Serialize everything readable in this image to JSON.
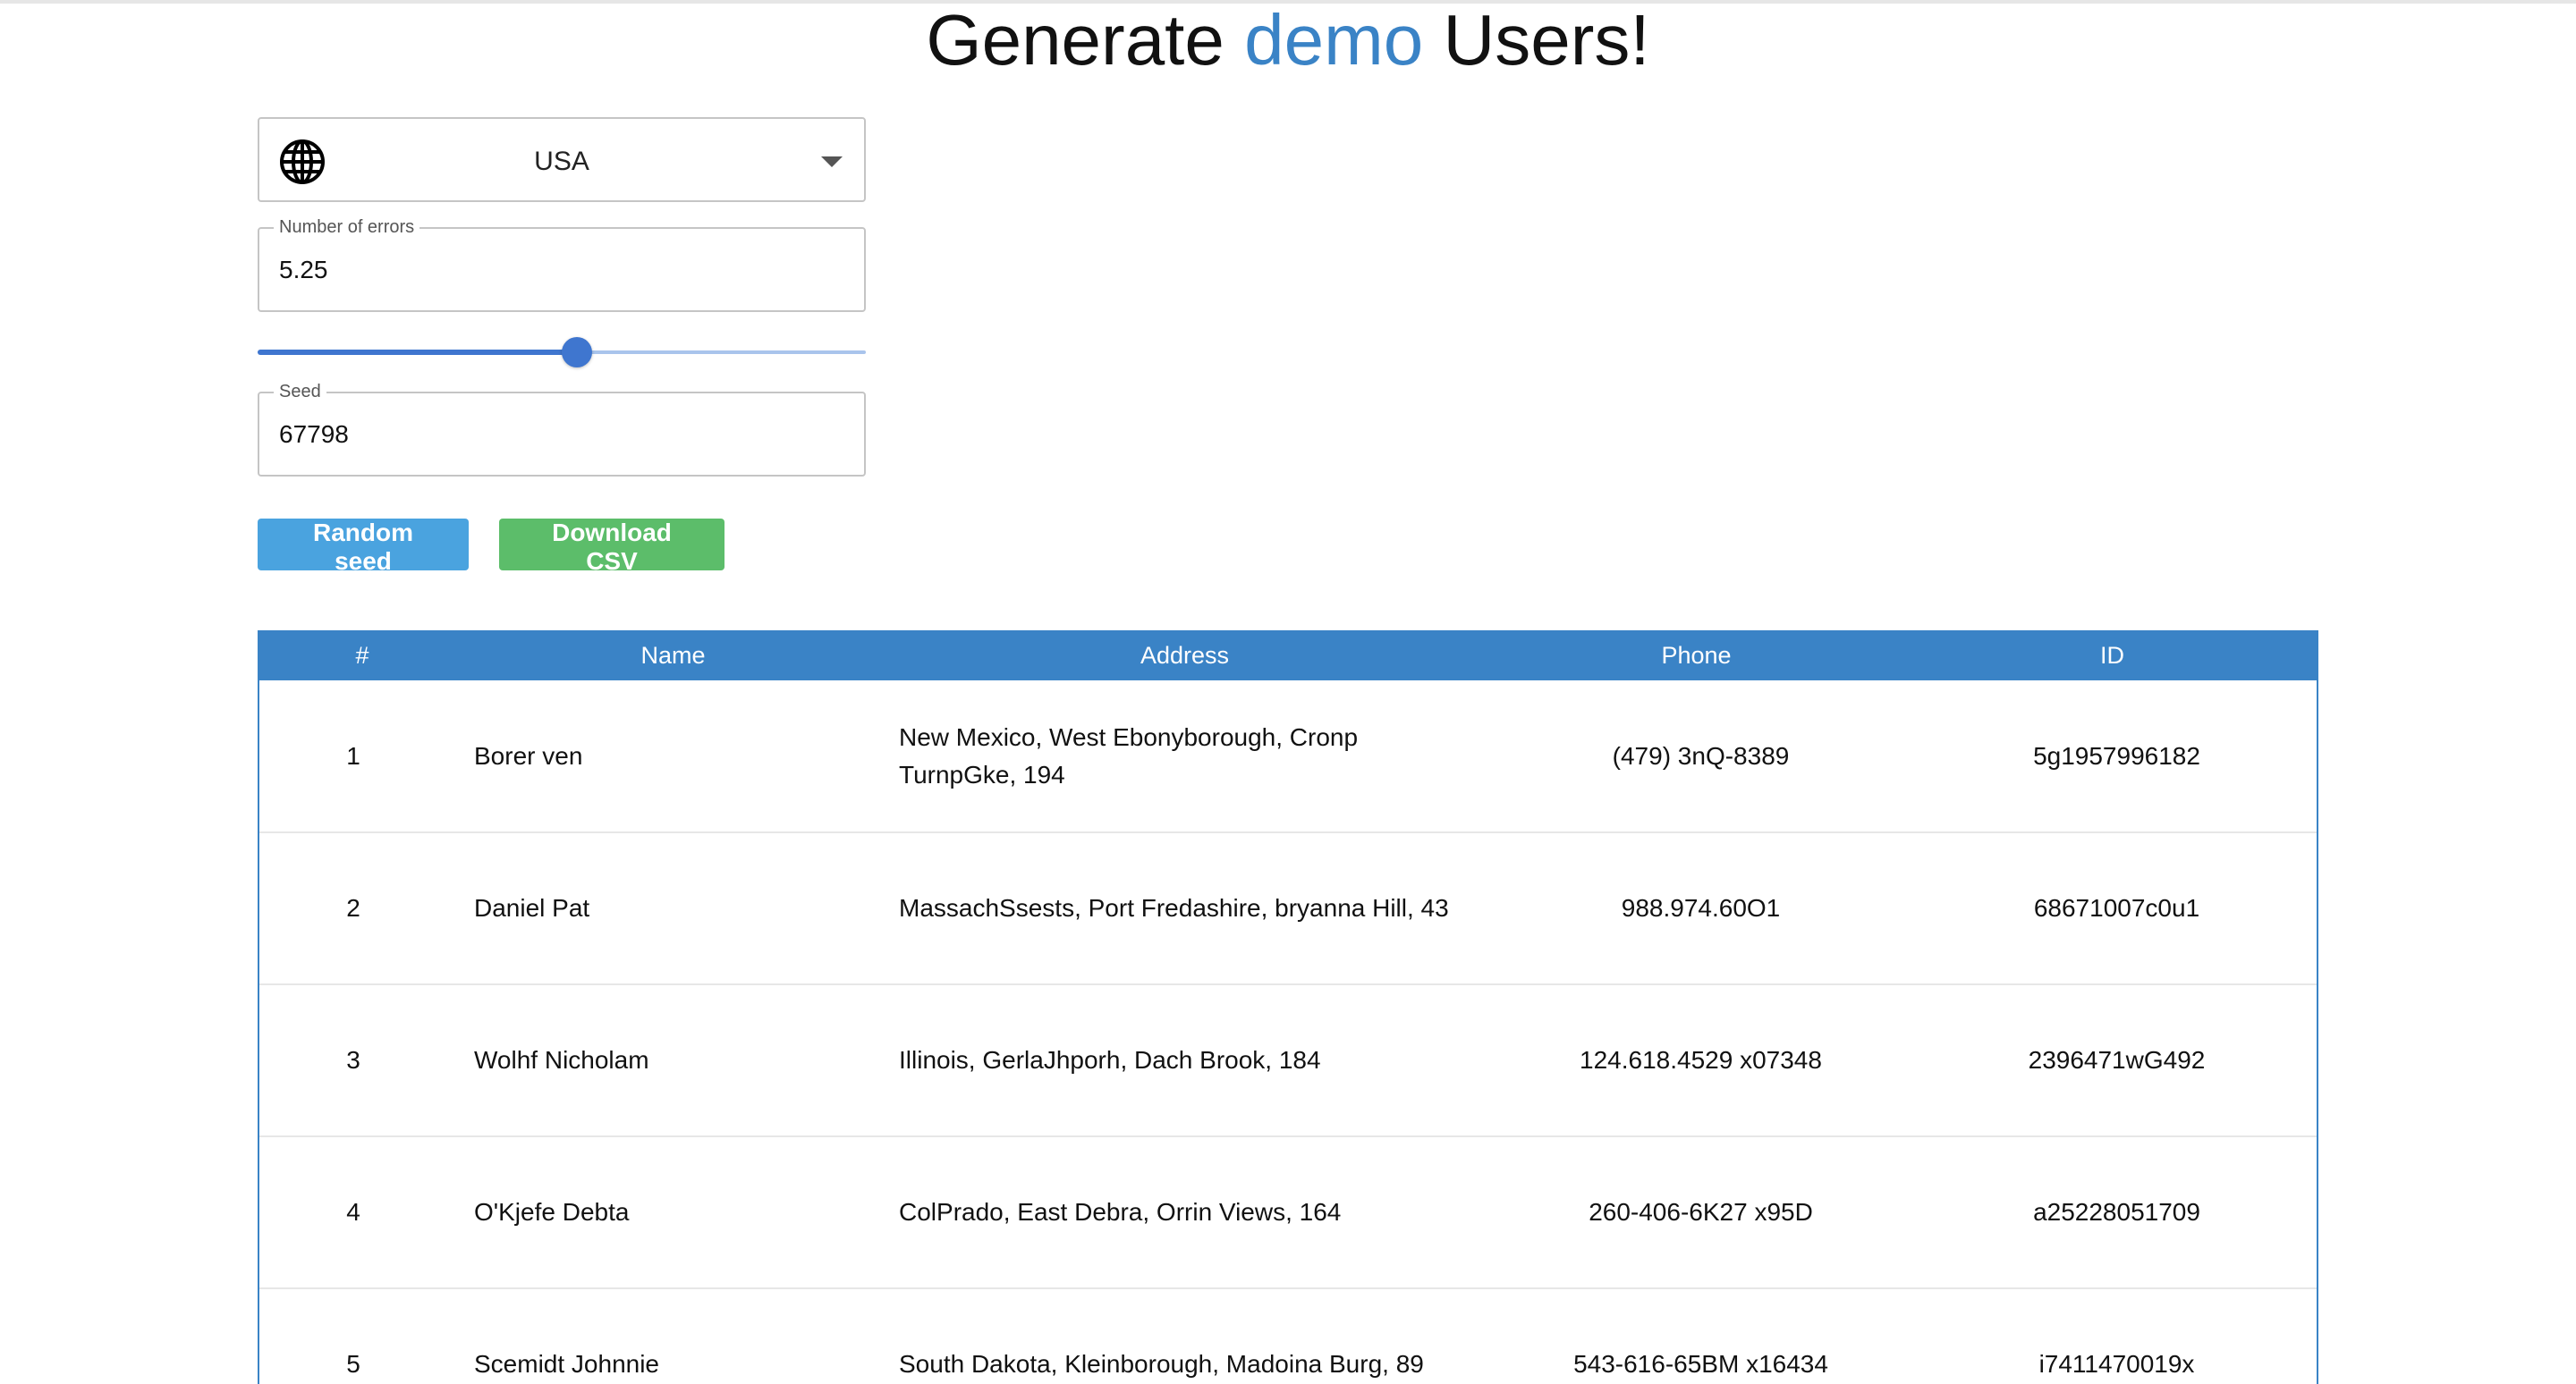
{
  "title": {
    "prefix": "Generate",
    "accent": "demo",
    "suffix": "Users!"
  },
  "colors": {
    "accent": "#3a83c6",
    "random_button": "#4aa3df",
    "csv_button": "#5cbd6a",
    "slider": "#3f76cf"
  },
  "region": {
    "icon": "globe-icon",
    "selected": "USA"
  },
  "errors": {
    "label": "Number of errors",
    "value": "5.25",
    "slider_fraction": 0.525
  },
  "seed": {
    "label": "Seed",
    "value": "67798"
  },
  "buttons": {
    "random_seed": "Random seed",
    "download_csv": "Download CSV"
  },
  "table": {
    "headers": [
      "#",
      "Name",
      "Address",
      "Phone",
      "ID"
    ],
    "rows": [
      {
        "num": "1",
        "name": "Borer ven",
        "address": "New Mexico, West Ebonyborough, Cronp TurnpGke, 194",
        "phone": "(479) 3nQ-8389",
        "id": "5g1957996182"
      },
      {
        "num": "2",
        "name": "Daniel Pat",
        "address": "MassachSsests, Port Fredashire, bryanna Hill, 43",
        "phone": "988.974.60O1",
        "id": "68671007c0u1"
      },
      {
        "num": "3",
        "name": "Wolhf Nicholam",
        "address": "Illinois, GerlaJhporh, Dach Brook, 184",
        "phone": "124.618.4529 x07348",
        "id": "2396471wG492"
      },
      {
        "num": "4",
        "name": "O'Kjefe Debta",
        "address": "ColPrado, East Debra, Orrin Views, 164",
        "phone": "260-406-6K27 x95D",
        "id": "a25228051709"
      },
      {
        "num": "5",
        "name": "Scemidt Johnnie",
        "address": "South Dakota, Kleinborough, Madoina Burg, 89",
        "phone": "543-616-65BM x16434",
        "id": "i7411470019x"
      }
    ]
  }
}
